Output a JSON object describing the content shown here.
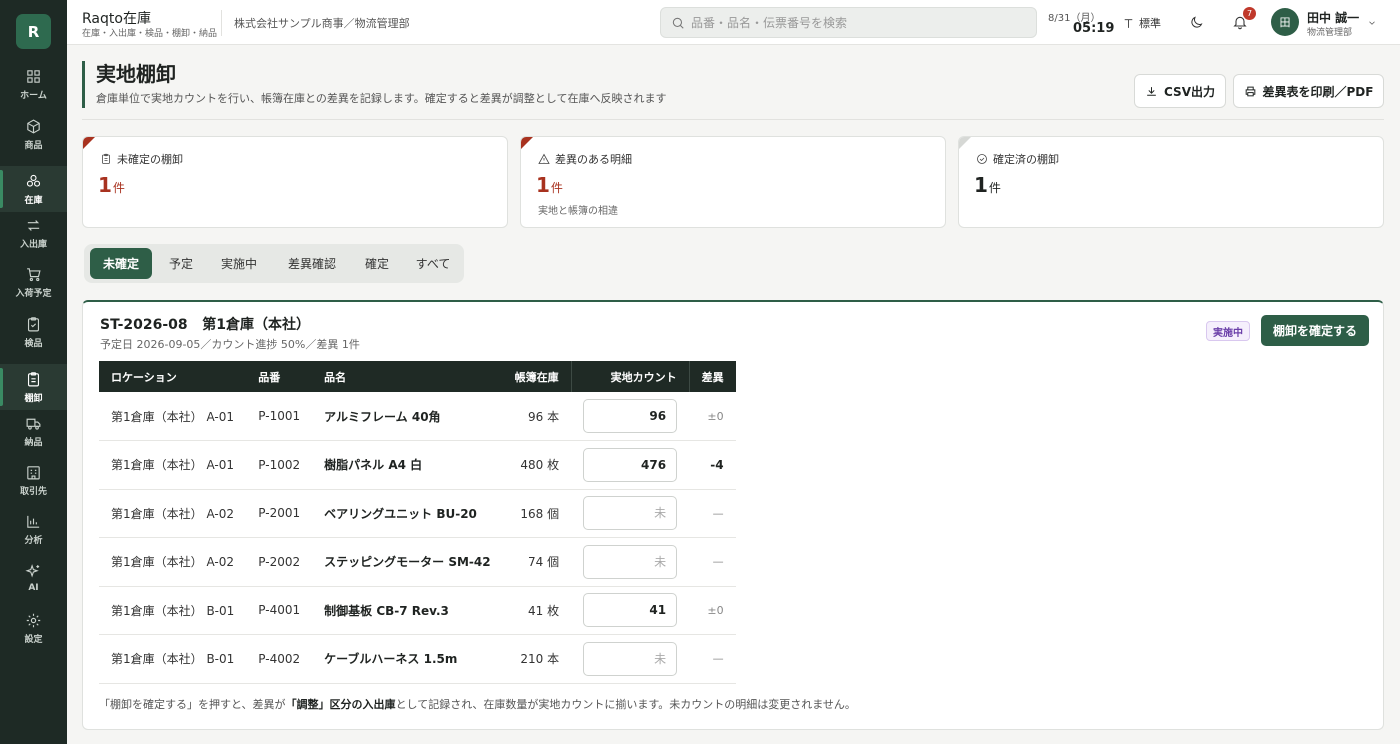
{
  "sidebar": {
    "logo": "R",
    "items": [
      {
        "icon": "grid-icon",
        "label": "ホーム"
      },
      {
        "icon": "box-icon",
        "label": "商品"
      },
      {
        "icon": "boxes-icon",
        "label": "在庫",
        "active": true
      },
      {
        "icon": "arrows-swap-icon",
        "label": "入出庫"
      },
      {
        "icon": "cart-icon",
        "label": "入荷予定"
      },
      {
        "icon": "clipboard-check-icon",
        "label": "検品"
      },
      {
        "icon": "clipboard-list-icon",
        "label": "棚卸"
      },
      {
        "icon": "truck-icon",
        "label": "納品"
      },
      {
        "icon": "building-icon",
        "label": "取引先"
      },
      {
        "icon": "chart-icon",
        "label": "分析"
      },
      {
        "icon": "sparkle-icon",
        "label": "AI"
      },
      {
        "icon": "gear-icon",
        "label": "設定"
      }
    ]
  },
  "header": {
    "app_title": "Raqto在庫",
    "app_subtitle": "在庫・入出庫・検品・棚卸・納品",
    "organization": "株式会社サンプル商事／物流管理部",
    "search_placeholder": "品番・品名・伝票番号を検索",
    "date": "8/31（月）",
    "time": "05:19",
    "font_size_label": "標準",
    "notification_count": "7",
    "user_initial": "田",
    "user_name": "田中 誠一",
    "user_role": "物流管理部"
  },
  "page": {
    "title": "実地棚卸",
    "description": "倉庫単位で実地カウントを行い、帳簿在庫との差異を記録します。確定すると差異が調整として在庫へ反映されます",
    "csv_button": "CSV出力",
    "print_button": "差異表を印刷／PDF"
  },
  "stats": [
    {
      "label": "未確定の棚卸",
      "value": "1",
      "unit": "件",
      "note": "",
      "tone": "red"
    },
    {
      "label": "差異のある明細",
      "value": "1",
      "unit": "件",
      "note": "実地と帳簿の相違",
      "tone": "red"
    },
    {
      "label": "確定済の棚卸",
      "value": "1",
      "unit": "件",
      "note": "",
      "tone": "dark"
    }
  ],
  "tabs": [
    "未確定",
    "予定",
    "実施中",
    "差異確認",
    "確定",
    "すべて"
  ],
  "active_tab": "未確定",
  "stocktake": {
    "id": "ST-2026-08",
    "warehouse": "第1倉庫（本社）",
    "subtitle": "予定日 2026-09-05／カウント進捗 50%／差異 1件",
    "status": "実施中",
    "confirm_button": "棚卸を確定する",
    "columns": [
      "ロケーション",
      "品番",
      "品名",
      "帳簿在庫",
      "実地カウント",
      "差異"
    ],
    "count_placeholder": "未",
    "rows": [
      {
        "location": "第1倉庫（本社） A-01",
        "code": "P-1001",
        "name": "アルミフレーム 40角",
        "book": "96 本",
        "count": "96",
        "diff": "±0"
      },
      {
        "location": "第1倉庫（本社） A-01",
        "code": "P-1002",
        "name": "樹脂パネル A4 白",
        "book": "480 枚",
        "count": "476",
        "diff": "-4"
      },
      {
        "location": "第1倉庫（本社） A-02",
        "code": "P-2001",
        "name": "ベアリングユニット BU-20",
        "book": "168 個",
        "count": "",
        "diff": "—"
      },
      {
        "location": "第1倉庫（本社） A-02",
        "code": "P-2002",
        "name": "ステッピングモーター SM-42",
        "book": "74 個",
        "count": "",
        "diff": "—"
      },
      {
        "location": "第1倉庫（本社） B-01",
        "code": "P-4001",
        "name": "制御基板 CB-7 Rev.3",
        "book": "41 枚",
        "count": "41",
        "diff": "±0"
      },
      {
        "location": "第1倉庫（本社） B-01",
        "code": "P-4002",
        "name": "ケーブルハーネス 1.5m",
        "book": "210 本",
        "count": "",
        "diff": "—"
      }
    ],
    "footnote_a": "「棚卸を確定する」を押すと、差異が",
    "footnote_b": "「調整」区分の入出庫",
    "footnote_c": "として記録され、在庫数量が実地カウントに揃います。未カウントの明細は変更されません。"
  }
}
